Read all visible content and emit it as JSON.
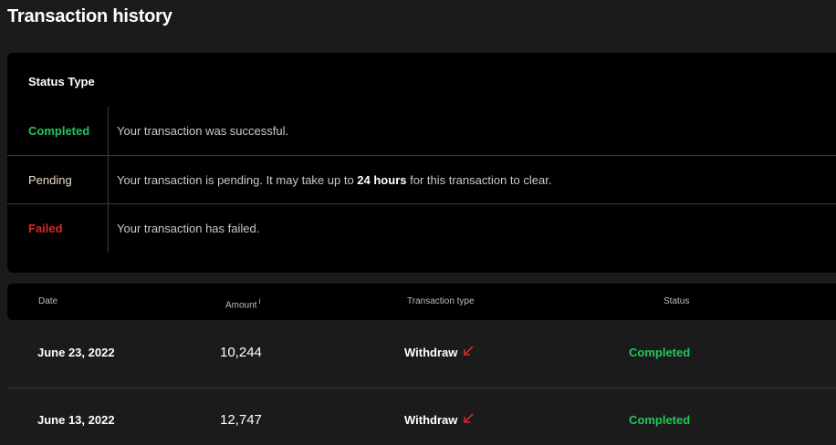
{
  "page": {
    "title": "Transaction history"
  },
  "status_legend": {
    "title": "Status Type",
    "items": [
      {
        "name": "Completed",
        "description": "Your transaction was successful."
      },
      {
        "name": "Pending",
        "description_before": "Your transaction is pending. It may take up to ",
        "description_emphasis": "24 hours",
        "description_after": " for this transaction to clear."
      },
      {
        "name": "Failed",
        "description": "Your transaction has failed."
      }
    ]
  },
  "table": {
    "headers": {
      "date": "Date",
      "amount": "Amount",
      "amount_info": "i",
      "type": "Transaction type",
      "status": "Status"
    },
    "rows": [
      {
        "date": "June 23, 2022",
        "amount": "10,244",
        "type": "Withdraw",
        "type_icon": "arrow-down-left-icon",
        "status": "Completed"
      },
      {
        "date": "June 13, 2022",
        "amount": "12,747",
        "type": "Withdraw",
        "type_icon": "arrow-down-left-icon",
        "status": "Completed"
      }
    ]
  },
  "colors": {
    "completed": "#22c55e",
    "pending": "#ebdcc9",
    "failed": "#d62828",
    "withdraw_arrow": "#d62828",
    "card_background": "#000000",
    "page_background": "#1b1b1b"
  }
}
